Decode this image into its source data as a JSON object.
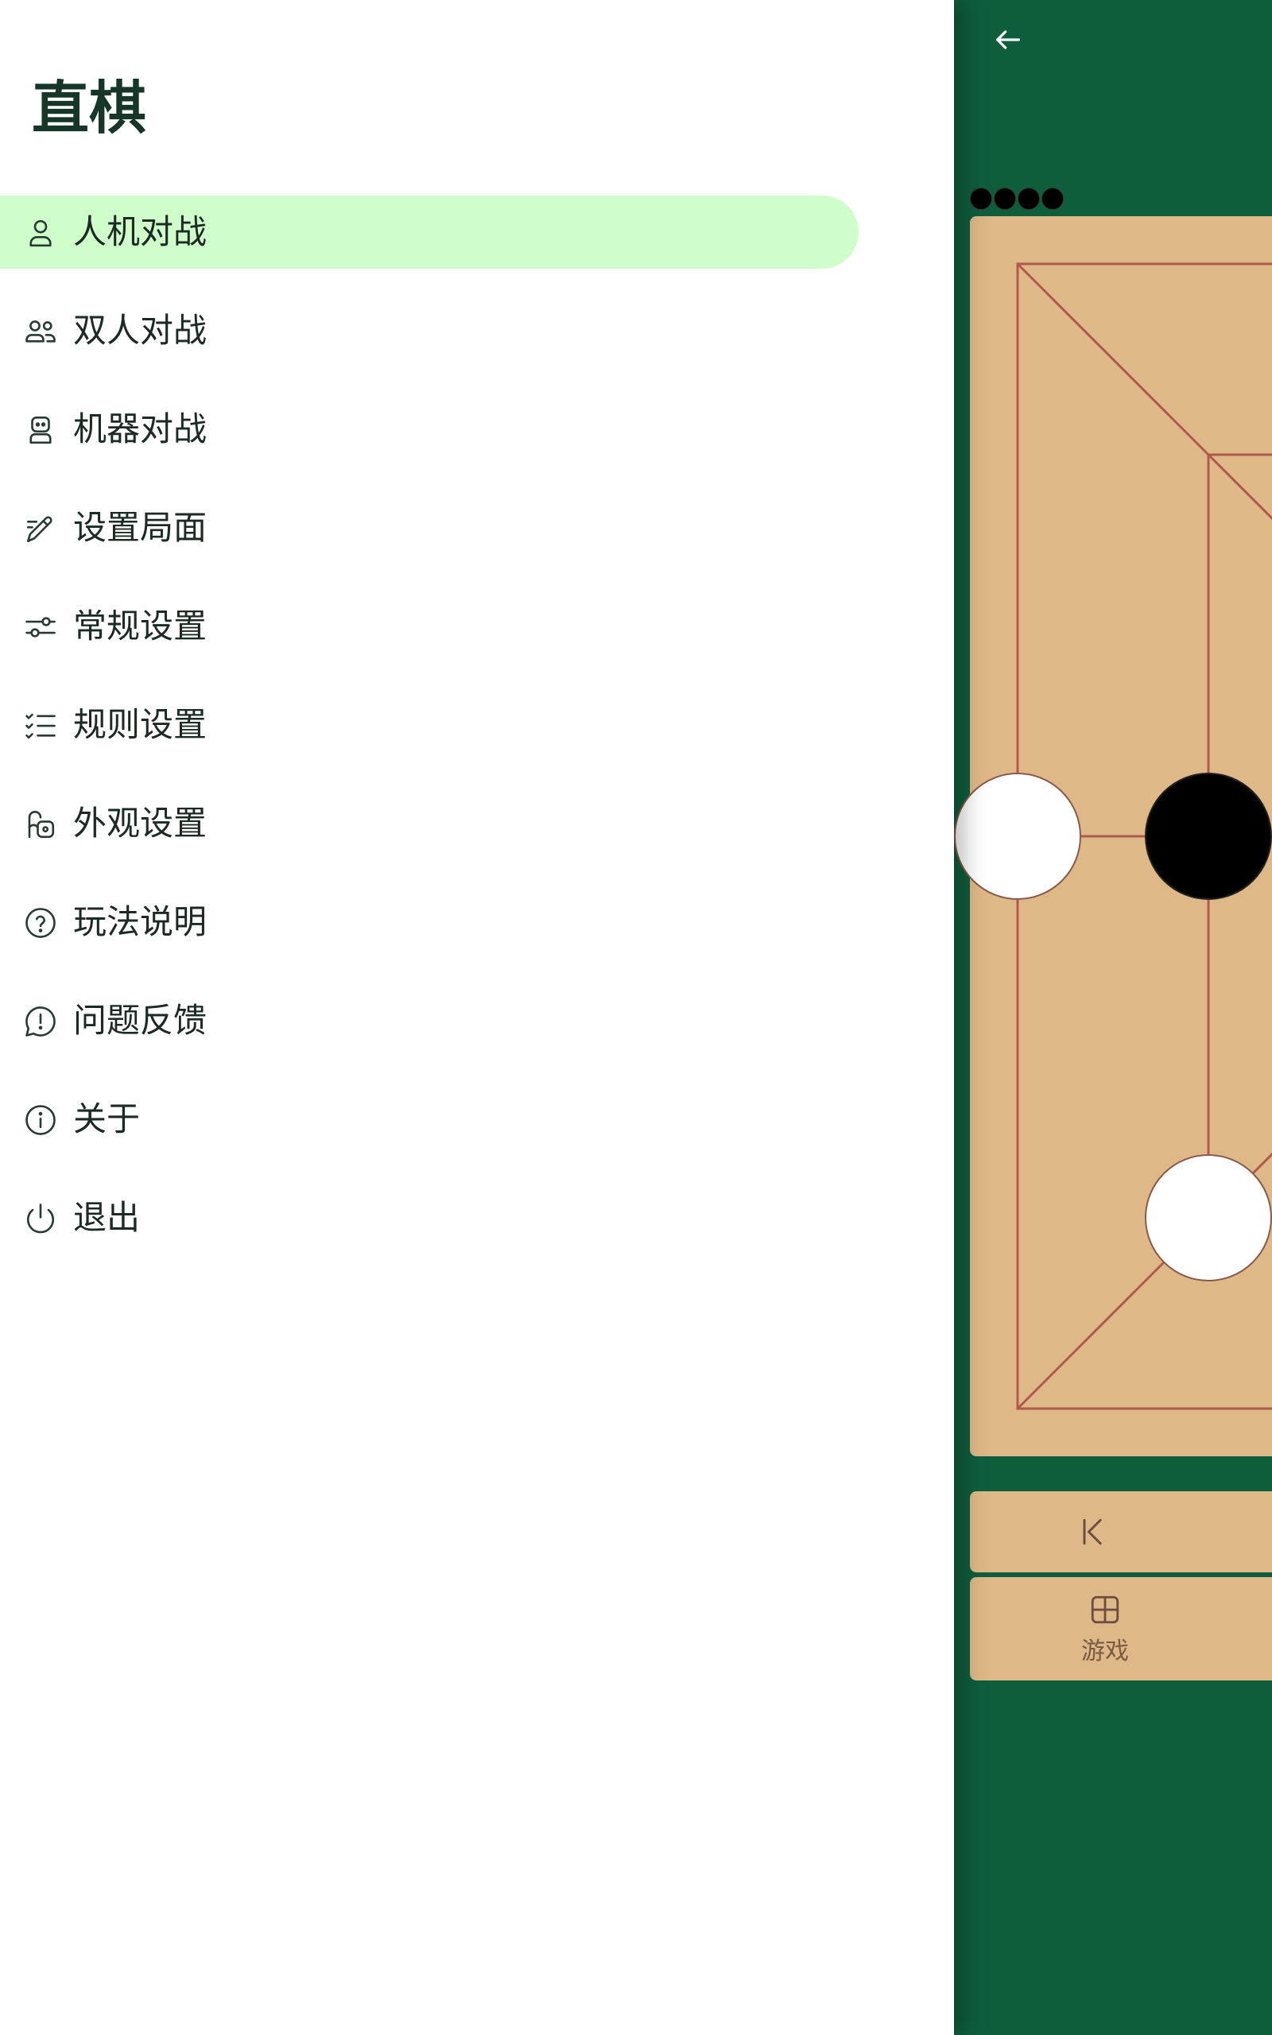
{
  "drawer": {
    "title": "直棋",
    "items": [
      {
        "label": "人机对战",
        "icon": "person-icon",
        "active": true
      },
      {
        "label": "双人对战",
        "icon": "people-icon",
        "active": false
      },
      {
        "label": "机器对战",
        "icon": "robot-icon",
        "active": false
      },
      {
        "label": "设置局面",
        "icon": "pencil-icon",
        "active": false
      },
      {
        "label": "常规设置",
        "icon": "sliders-icon",
        "active": false
      },
      {
        "label": "规则设置",
        "icon": "checklist-icon",
        "active": false
      },
      {
        "label": "外观设置",
        "icon": "palette-icon",
        "active": false
      },
      {
        "label": "玩法说明",
        "icon": "help-icon",
        "active": false
      },
      {
        "label": "问题反馈",
        "icon": "feedback-icon",
        "active": false
      },
      {
        "label": "关于",
        "icon": "info-icon",
        "active": false
      },
      {
        "label": "退出",
        "icon": "power-icon",
        "active": false
      }
    ]
  },
  "game": {
    "back_icon": "arrow-left-icon",
    "remaining_pieces_count": 4,
    "controls": {
      "first_move_icon": "first-move-icon",
      "game_menu_icon": "grid-icon",
      "game_menu_label": "游戏"
    }
  },
  "colors": {
    "background": "#0e5e3c",
    "board": "#deb887",
    "board_lines": "#b05a4e",
    "active_item": "#cffecb",
    "title_text": "#17362a"
  }
}
